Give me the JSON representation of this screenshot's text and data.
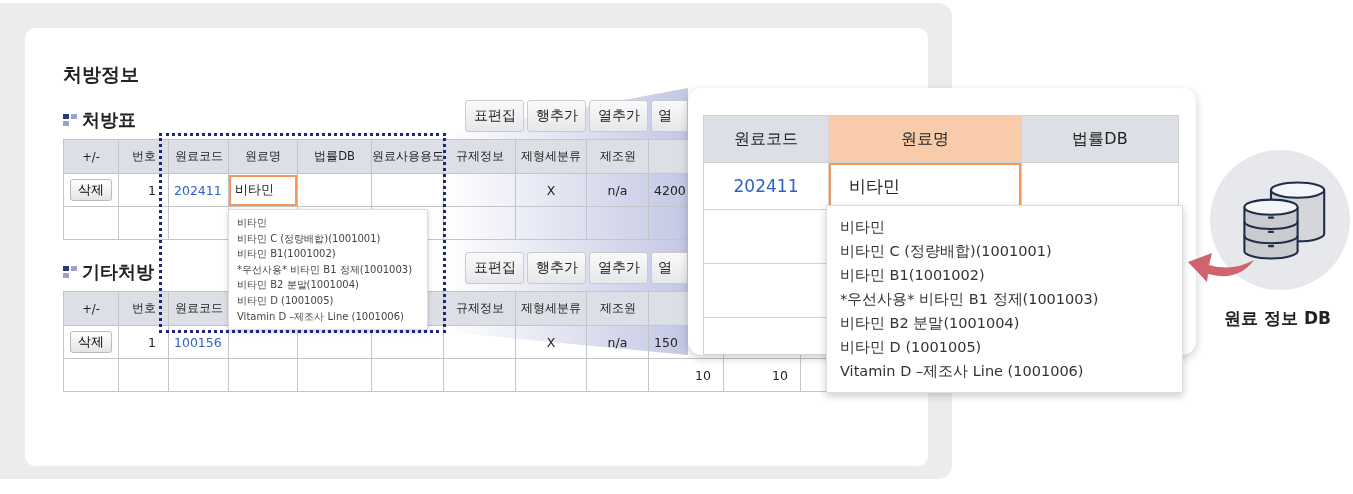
{
  "page_title": "처방정보",
  "sections": [
    {
      "title": "처방표",
      "toolbar": [
        "표편집",
        "행추가",
        "열추가",
        "열"
      ],
      "columns": [
        {
          "label": "+/-"
        },
        {
          "label": "번호"
        },
        {
          "label": "원료코드"
        },
        {
          "label": "원료명"
        },
        {
          "label": "법률DB"
        },
        {
          "label": "원료사용용도"
        },
        {
          "label": "규제정보"
        },
        {
          "label": "제형세분류"
        },
        {
          "label": "제조원"
        },
        {},
        {},
        {}
      ],
      "rows": [
        {
          "kind": "data",
          "cells": [
            {
              "kind": "button",
              "text": "삭제"
            },
            {
              "kind": "number",
              "text": "1"
            },
            {
              "kind": "link",
              "text": "202411"
            },
            {
              "kind": "input",
              "value": "비타민",
              "selected": true
            },
            {
              "kind": "empty"
            },
            {
              "kind": "empty"
            },
            {
              "kind": "empty"
            },
            {
              "kind": "center",
              "text": "X"
            },
            {
              "kind": "center",
              "text": "n/a"
            },
            {
              "kind": "left",
              "text": "4200"
            },
            {
              "kind": "empty"
            },
            {
              "kind": "empty"
            }
          ]
        },
        {
          "kind": "blank"
        }
      ],
      "suggestions": [
        "비타민",
        "비타민 C (정량배합)(1001001)",
        "비타민 B1(1001002)",
        "*우선사용* 비타민 B1 정제(1001003)",
        "비타민 B2 분말(1001004)",
        "비타민 D (1001005)",
        "Vitamin D –제조사 Line (1001006)"
      ]
    },
    {
      "title": "기타처방",
      "toolbar": [
        "표편집",
        "행추가",
        "열추가",
        "열"
      ],
      "columns": [
        {
          "label": "+/-"
        },
        {
          "label": "번호"
        },
        {
          "label": "원료코드"
        },
        {},
        {},
        {},
        {
          "label": "규제정보"
        },
        {
          "label": "제형세분류"
        },
        {
          "label": "제조원"
        },
        {},
        {},
        {}
      ],
      "rows": [
        {
          "kind": "data",
          "cells": [
            {
              "kind": "button",
              "text": "삭제"
            },
            {
              "kind": "number",
              "text": "1"
            },
            {
              "kind": "link",
              "text": "100156"
            },
            {
              "kind": "empty"
            },
            {
              "kind": "empty"
            },
            {
              "kind": "empty"
            },
            {
              "kind": "empty"
            },
            {
              "kind": "center",
              "text": "X"
            },
            {
              "kind": "center",
              "text": "n/a"
            },
            {
              "kind": "left",
              "text": "150"
            },
            {
              "kind": "empty"
            },
            {
              "kind": "empty"
            }
          ]
        },
        {
          "kind": "data",
          "cells": [
            {
              "kind": "empty"
            },
            {
              "kind": "empty"
            },
            {
              "kind": "empty"
            },
            {
              "kind": "empty"
            },
            {
              "kind": "empty"
            },
            {
              "kind": "empty"
            },
            {
              "kind": "empty"
            },
            {
              "kind": "empty"
            },
            {
              "kind": "empty"
            },
            {
              "kind": "number",
              "text": "10"
            },
            {
              "kind": "number",
              "text": "10"
            },
            {
              "kind": "empty"
            }
          ]
        }
      ]
    }
  ],
  "zoom": {
    "columns": [
      {
        "label": "원료코드",
        "selected": false
      },
      {
        "label": "원료명",
        "selected": true
      },
      {
        "label": "법률DB",
        "selected": false
      }
    ],
    "rows": [
      {
        "kind": "data",
        "cells": [
          {
            "kind": "link",
            "text": "202411"
          },
          {
            "kind": "input",
            "value": "비타민",
            "selected": true
          },
          {
            "kind": "empty"
          }
        ]
      },
      {
        "kind": "blank"
      },
      {
        "kind": "blank"
      },
      {
        "kind": "blank"
      }
    ],
    "suggestions": [
      "비타민",
      "비타민 C (정량배합)(1001001)",
      "비타민 B1(1001002)",
      "*우선사용* 비타민 B1 정제(1001003)",
      "비타민 B2 분말(1001004)",
      "비타민 D (1001005)",
      "Vitamin D –제조사 Line (1001006)"
    ]
  },
  "database": {
    "label": "원료 정보 DB"
  }
}
